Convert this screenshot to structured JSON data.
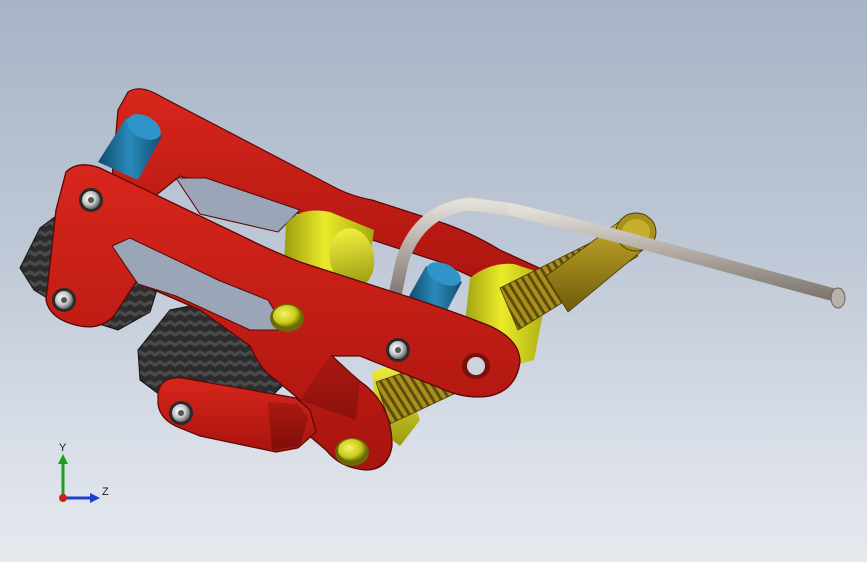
{
  "viewport": {
    "background_top": "#a7b4c6",
    "background_bottom": "#e6e9ee"
  },
  "model": {
    "frame_color": "#c41a14",
    "frame_edge_color": "#5a0806",
    "roller_color": "#d9d917",
    "pin_color": "#1c6c96",
    "tread_color": "#2a2a2a",
    "rod_color": "#b8b2aa",
    "thread_color": "#a58d1c",
    "bolt_color": "#d0d0d0"
  },
  "triad": {
    "y_label": "Y",
    "z_label": "Z",
    "y_color": "#1e9e1e",
    "z_color": "#1e3fd0",
    "x_color": "#d01e1e"
  }
}
